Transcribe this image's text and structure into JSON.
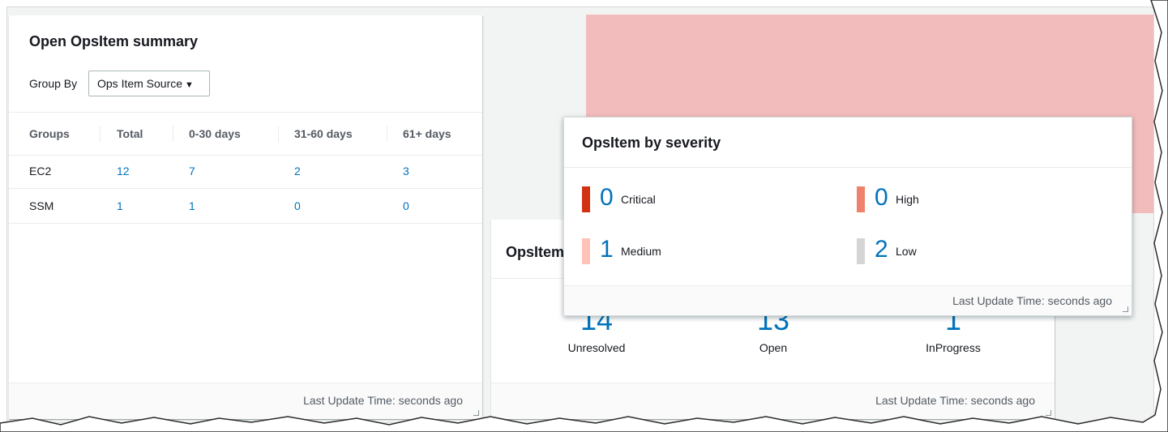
{
  "summary": {
    "title": "Open OpsItem summary",
    "group_by_label": "Group By",
    "group_by_value": "Ops Item Source",
    "columns": [
      "Groups",
      "Total",
      "0-30 days",
      "31-60 days",
      "61+ days"
    ],
    "rows": [
      [
        "EC2",
        "12",
        "7",
        "2",
        "3"
      ],
      [
        "SSM",
        "1",
        "1",
        "0",
        "0"
      ]
    ],
    "footer": "Last Update Time: seconds ago"
  },
  "status": {
    "title": "OpsItem",
    "stats": [
      {
        "value": "14",
        "label": "Unresolved"
      },
      {
        "value": "13",
        "label": "Open"
      },
      {
        "value": "1",
        "label": "InProgress"
      }
    ],
    "footer": "Last Update Time: seconds ago"
  },
  "severity": {
    "title": "OpsItem by severity",
    "items": [
      {
        "value": "0",
        "label": "Critical",
        "color": "#d13212"
      },
      {
        "value": "0",
        "label": "High",
        "color": "#f0826d"
      },
      {
        "value": "1",
        "label": "Medium",
        "color": "#ffc2b7"
      },
      {
        "value": "2",
        "label": "Low",
        "color": "#d5d5d5"
      }
    ],
    "footer": "Last Update Time: seconds ago"
  },
  "colors": {
    "link": "#0073bb",
    "pink_block": "#f3bcbc"
  }
}
